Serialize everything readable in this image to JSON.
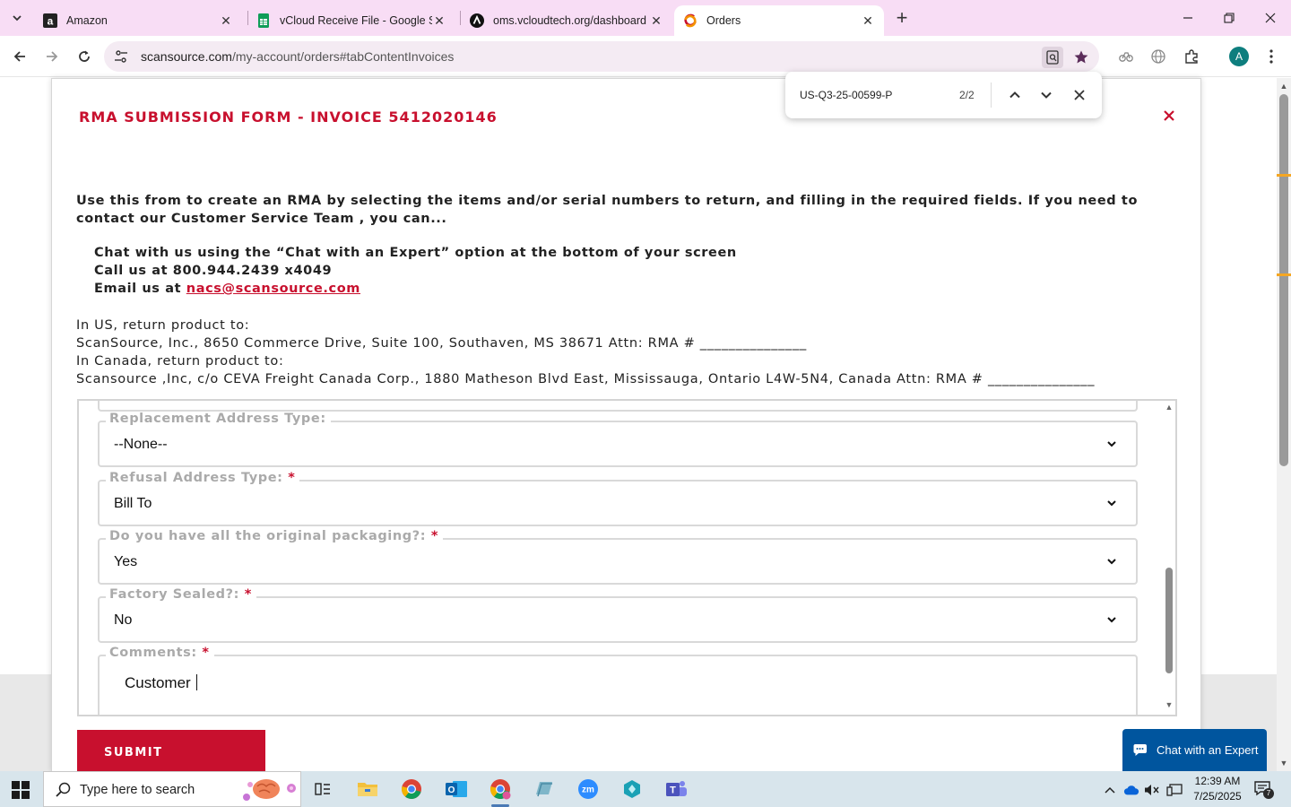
{
  "browser": {
    "tabs": [
      {
        "title": "Amazon",
        "icon": "amazon-icon",
        "active": false
      },
      {
        "title": "vCloud Receive File - Google Sh",
        "icon": "google-sheets-icon",
        "active": false
      },
      {
        "title": "oms.vcloudtech.org/dashboard",
        "icon": "oms-icon",
        "active": false
      },
      {
        "title": "Orders",
        "icon": "scansource-icon",
        "active": true
      }
    ],
    "url_host": "scansource.com",
    "url_path": "/my-account/orders#tabContentInvoices",
    "profile_initial": "A"
  },
  "find_bar": {
    "query": "US-Q3-25-00599-P",
    "count": "2/2"
  },
  "modal": {
    "title": "RMA SUBMISSION FORM - INVOICE 5412020146",
    "intro": "Use this from to create an RMA by selecting the items and/or serial numbers to return, and filling in the required fields. If you need to contact our Customer Service Team , you can...",
    "contact_chat": "Chat with us using the “Chat with an Expert” option at the bottom of your screen",
    "contact_call": "Call us at 800.944.2439 x4049",
    "contact_email_prefix": "Email us at ",
    "contact_email": "nacs@scansource.com",
    "us_return_label": "In US, return product to:",
    "us_return_address": "ScanSource, Inc., 8650 Commerce Drive, Suite 100, Southaven, MS 38671 Attn: RMA # _______________",
    "ca_return_label": "In Canada, return product to:",
    "ca_return_address": "Scansource ,Inc, c/o CEVA Freight Canada Corp., 1880 Matheson Blvd East, Mississauga, Ontario L4W-5N4, Canada Attn: RMA # _______________",
    "fields": [
      {
        "label": "Replacement Address Type:",
        "required": "",
        "value": "--None--"
      },
      {
        "label": "Refusal Address Type:",
        "required": "*",
        "value": "Bill To"
      },
      {
        "label": "Do you have all the original packaging?:",
        "required": "*",
        "value": "Yes"
      },
      {
        "label": "Factory Sealed?:",
        "required": "*",
        "value": "No"
      }
    ],
    "comments": {
      "label": "Comments:",
      "required": "*",
      "value": "Customer "
    },
    "submit_label": "SUBMIT"
  },
  "chat_button": "Chat with an Expert",
  "taskbar": {
    "search_placeholder": "Type here to search",
    "time": "12:39 AM",
    "date": "7/25/2025",
    "notification_count": "7"
  },
  "colors": {
    "brand_red": "#c8102e",
    "chat_blue": "#00559e",
    "tab_strip": "#f8ddf5"
  }
}
